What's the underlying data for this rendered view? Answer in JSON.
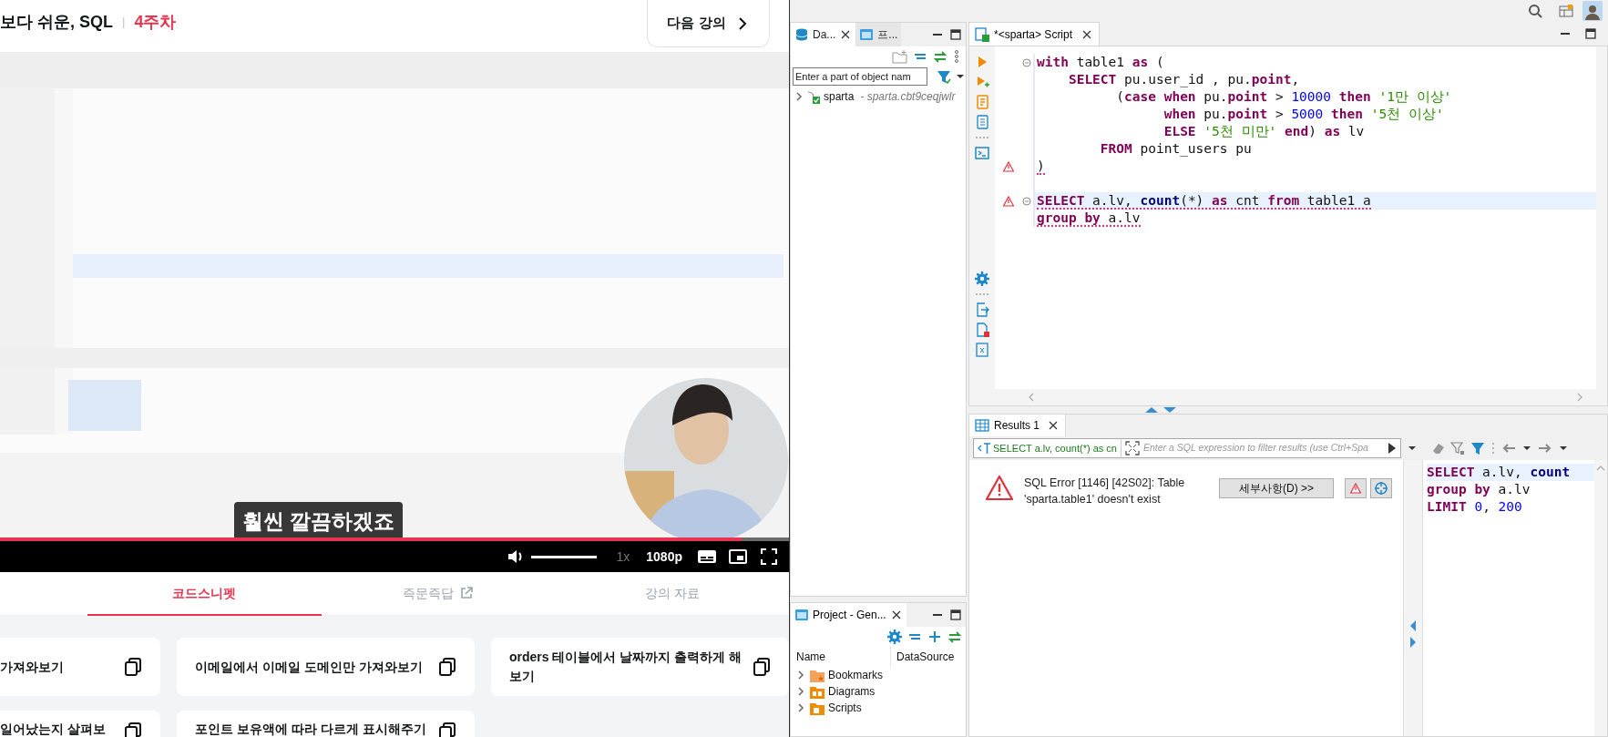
{
  "lecture_header": {
    "title": "보다 쉬운, SQL",
    "separator": "|",
    "week": "4주차",
    "next_button": "다음 강의"
  },
  "video_player": {
    "subtitle": "훨씬 깔끔하겠죠",
    "progress": {
      "level": 0.94
    },
    "volume": {
      "level": 1
    },
    "speed": "1x",
    "quality": "1080p"
  },
  "lecture_tabs": [
    {
      "label": "코드스니펫",
      "selected": true,
      "external": false
    },
    {
      "label": "즉문즉답",
      "selected": false,
      "external": true
    },
    {
      "label": "강의 자료",
      "selected": false,
      "external": false
    }
  ],
  "snippets": [
    {
      "title": "가져와보기"
    },
    {
      "title": "이메일에서 이메일 도메인만 가져와보기"
    },
    {
      "title": "orders 테이블에서 날짜까지 출력하게 해 보기"
    },
    {
      "title": "일어났는지 살펴보"
    },
    {
      "title": "포인트 보유액에 따라 다르게 표시해주기"
    }
  ],
  "dbeaver": {
    "navigator": {
      "tabs": [
        {
          "label": "Da...",
          "selected": true
        },
        {
          "label": "프...",
          "selected": false
        }
      ],
      "filter": {
        "placeholder": "Enter a part of object nam"
      },
      "tree": [
        {
          "label": "sparta",
          "detail": "- sparta.cbt9ceqjwlr",
          "expanded": false
        }
      ]
    },
    "project": {
      "tab": "Project - Gen...",
      "columns": [
        "Name",
        "DataSource"
      ],
      "items": [
        {
          "label": "Bookmarks",
          "kind": "bookmarks",
          "expanded": false
        },
        {
          "label": "Diagrams",
          "kind": "diagrams",
          "expanded": false
        },
        {
          "label": "Scripts",
          "kind": "scripts",
          "expanded": false
        }
      ]
    },
    "editor": {
      "tab": "*<sparta> Script",
      "lines": [
        {
          "fold": true,
          "warning": false,
          "current": false,
          "squiggle": false,
          "tokens": [
            {
              "kind": "keyword",
              "text": "with"
            },
            {
              "kind": "plain",
              "text": " table1 "
            },
            {
              "kind": "keyword",
              "text": "as"
            },
            {
              "kind": "plain",
              "text": " ("
            }
          ]
        },
        {
          "fold": false,
          "warning": false,
          "current": false,
          "squiggle": false,
          "tokens": [
            {
              "kind": "keyword",
              "text": "    SELECT"
            },
            {
              "kind": "plain",
              "text": " pu.user_id , pu."
            },
            {
              "kind": "keyword",
              "text": "point"
            },
            {
              "kind": "plain",
              "text": ","
            }
          ]
        },
        {
          "fold": false,
          "warning": false,
          "current": false,
          "squiggle": false,
          "tokens": [
            {
              "kind": "plain",
              "text": "          ("
            },
            {
              "kind": "keyword",
              "text": "case"
            },
            {
              "kind": "keyword",
              "text": " when"
            },
            {
              "kind": "plain",
              "text": " pu."
            },
            {
              "kind": "keyword",
              "text": "point"
            },
            {
              "kind": "plain",
              "text": " > "
            },
            {
              "kind": "number",
              "text": "10000"
            },
            {
              "kind": "keyword",
              "text": " then"
            },
            {
              "kind": "string",
              "text": " '1만 이상'"
            }
          ]
        },
        {
          "fold": false,
          "warning": false,
          "current": false,
          "squiggle": false,
          "tokens": [
            {
              "kind": "keyword",
              "text": "                when"
            },
            {
              "kind": "plain",
              "text": " pu."
            },
            {
              "kind": "keyword",
              "text": "point"
            },
            {
              "kind": "plain",
              "text": " > "
            },
            {
              "kind": "number",
              "text": "5000"
            },
            {
              "kind": "keyword",
              "text": " then"
            },
            {
              "kind": "string",
              "text": " '5천 이상'"
            }
          ]
        },
        {
          "fold": false,
          "warning": false,
          "current": false,
          "squiggle": false,
          "tokens": [
            {
              "kind": "keyword",
              "text": "                ELSE"
            },
            {
              "kind": "string",
              "text": " '5천 미만'"
            },
            {
              "kind": "keyword",
              "text": " end"
            },
            {
              "kind": "plain",
              "text": ") "
            },
            {
              "kind": "keyword",
              "text": "as"
            },
            {
              "kind": "plain",
              "text": " lv"
            }
          ]
        },
        {
          "fold": false,
          "warning": false,
          "current": false,
          "squiggle": false,
          "tokens": [
            {
              "kind": "keyword",
              "text": "        FROM"
            },
            {
              "kind": "plain",
              "text": " point_users pu"
            }
          ]
        },
        {
          "fold": false,
          "warning": true,
          "current": false,
          "squiggle": true,
          "tokens": [
            {
              "kind": "plain",
              "text": ")"
            }
          ]
        },
        {
          "fold": false,
          "warning": false,
          "current": false
        },
        {
          "fold": true,
          "warning": true,
          "current": true,
          "squiggle": true,
          "tokens": [
            {
              "kind": "keyword",
              "text": "SELECT"
            },
            {
              "kind": "plain",
              "text": " a.lv, "
            },
            {
              "kind": "function",
              "text": "count"
            },
            {
              "kind": "plain",
              "text": "(*) "
            },
            {
              "kind": "keyword",
              "text": "as"
            },
            {
              "kind": "plain",
              "text": " cnt "
            },
            {
              "kind": "keyword",
              "text": "from"
            },
            {
              "kind": "plain",
              "text": " table1 a"
            }
          ]
        },
        {
          "fold": false,
          "warning": false,
          "current": false,
          "squiggle": true,
          "tokens": [
            {
              "kind": "keyword",
              "text": "group"
            },
            {
              "kind": "keyword",
              "text": " by"
            },
            {
              "kind": "plain",
              "text": " a.lv"
            }
          ]
        }
      ]
    },
    "results": {
      "tab": "Results 1",
      "query": "SELECT a.lv, count(*) as cn",
      "filter_placeholder": "Enter a SQL expression to filter results (use Ctrl+Spa",
      "error": "SQL Error [1146] [42S02]: Table 'sparta.table1' doesn't exist",
      "details_button": "세부사항(D) >>",
      "query_text": [
        {
          "current": true,
          "tokens": [
            {
              "kind": "keyword",
              "text": "SELECT"
            },
            {
              "kind": "plain",
              "text": " a.lv, "
            },
            {
              "kind": "function",
              "text": "count"
            }
          ]
        },
        {
          "current": false,
          "tokens": [
            {
              "kind": "keyword",
              "text": "group"
            },
            {
              "kind": "keyword",
              "text": " by"
            },
            {
              "kind": "plain",
              "text": " a.lv"
            }
          ]
        },
        {
          "current": false,
          "tokens": [
            {
              "kind": "keyword",
              "text": "LIMIT"
            },
            {
              "kind": "number",
              "text": " 0"
            },
            {
              "kind": "plain",
              "text": ", "
            },
            {
              "kind": "number",
              "text": "200"
            }
          ]
        }
      ]
    }
  }
}
